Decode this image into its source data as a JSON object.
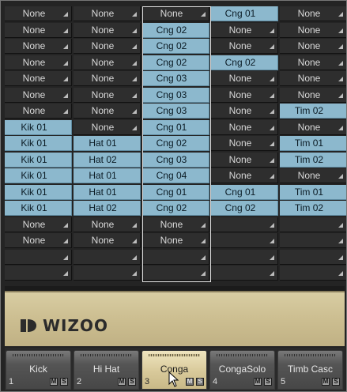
{
  "grid": {
    "rows": [
      [
        "None",
        "None",
        "None",
        "Cng 01",
        "None"
      ],
      [
        "None",
        "None",
        "Cng 02",
        "None",
        "None"
      ],
      [
        "None",
        "None",
        "Cng 02",
        "None",
        "None"
      ],
      [
        "None",
        "None",
        "Cng 02",
        "Cng 02",
        "None"
      ],
      [
        "None",
        "None",
        "Cng 03",
        "None",
        "None"
      ],
      [
        "None",
        "None",
        "Cng 03",
        "None",
        "None"
      ],
      [
        "None",
        "None",
        "Cng 03",
        "None",
        "Tim 02"
      ],
      [
        "Kik 01",
        "None",
        "Cng 01",
        "None",
        "None"
      ],
      [
        "Kik 01",
        "Hat 01",
        "Cng 02",
        "None",
        "Tim 01"
      ],
      [
        "Kik 01",
        "Hat 02",
        "Cng 03",
        "None",
        "Tim 02"
      ],
      [
        "Kik 01",
        "Hat 01",
        "Cng 04",
        "None",
        "None"
      ],
      [
        "Kik 01",
        "Hat 01",
        "Cng 01",
        "Cng 01",
        "Tim 01"
      ],
      [
        "Kik 01",
        "Hat 02",
        "Cng 02",
        "Cng 02",
        "Tim 02"
      ],
      [
        "None",
        "None",
        "None",
        "",
        ""
      ],
      [
        "None",
        "None",
        "None",
        "",
        ""
      ],
      [
        "",
        "",
        "",
        "",
        ""
      ],
      [
        "",
        "",
        "",
        "",
        ""
      ]
    ],
    "selected_column": 2
  },
  "banner": {
    "logo_text": "WIZOO"
  },
  "tabs": [
    {
      "name": "Kick",
      "number": "1",
      "m": "M",
      "s": "S",
      "active": false
    },
    {
      "name": "Hi Hat",
      "number": "2",
      "m": "M",
      "s": "S",
      "active": false
    },
    {
      "name": "Conga",
      "number": "3",
      "m": "M",
      "s": "S",
      "active": true
    },
    {
      "name": "CongaSolo",
      "number": "4",
      "m": "M",
      "s": "S",
      "active": false
    },
    {
      "name": "Timb Casc",
      "number": "5",
      "m": "M",
      "s": "S",
      "active": false
    }
  ],
  "colors": {
    "assigned_cell": "#8cb8cd",
    "empty_cell": "#2e2e2e",
    "banner": "#d4c89c",
    "active_tab": "#e2d5a9"
  }
}
